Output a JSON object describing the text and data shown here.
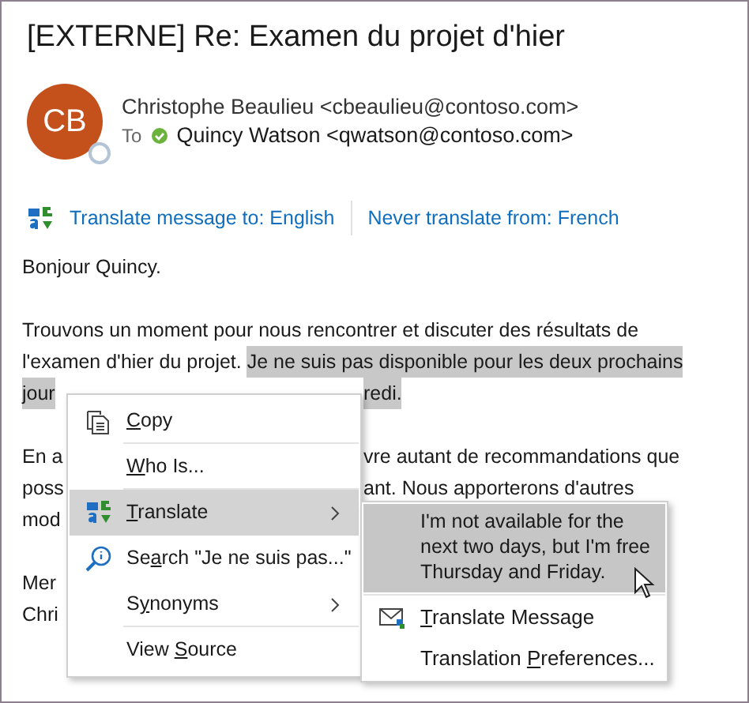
{
  "message": {
    "subject": "[EXTERNE] Re: Examen du projet d'hier",
    "sender": {
      "initials": "CB",
      "name": "Christophe Beaulieu <cbeaulieu@contoso.com>"
    },
    "to_label": "To",
    "recipient": "Quincy Watson <qwatson@contoso.com>"
  },
  "translate_bar": {
    "links": [
      "Translate message to: English",
      "Never translate from: French"
    ]
  },
  "body": [
    [
      {
        "left": [
          {
            "text": "Bonjour Quincy.",
            "highlighted": false
          }
        ]
      }
    ],
    [
      {
        "left": [
          {
            "text": "Trouvons un moment pour nous rencontrer et discuter des résultats de",
            "highlighted": false
          }
        ]
      },
      {
        "left": [
          {
            "text": "l'examen d'hier du projet. ",
            "highlighted": false
          },
          {
            "text": "Je ne suis pas disponible pour les deux prochains",
            "highlighted": true
          }
        ]
      },
      {
        "left": [
          {
            "text": "jour",
            "highlighted": true
          }
        ],
        "right": [
          {
            "text": "redi.",
            "highlighted": true
          }
        ]
      }
    ],
    [
      {
        "left": [
          {
            "text": "En a",
            "highlighted": false
          }
        ],
        "right": [
          {
            "text": "vre autant de recommandations que",
            "highlighted": false
          }
        ]
      },
      {
        "left": [
          {
            "text": "poss",
            "highlighted": false
          }
        ],
        "right": [
          {
            "text": "ant. Nous apporterons d'autres",
            "highlighted": false
          }
        ]
      },
      {
        "left": [
          {
            "text": "mod",
            "highlighted": false
          }
        ]
      }
    ],
    [
      {
        "left": [
          {
            "text": "Mer",
            "highlighted": false
          }
        ]
      },
      {
        "left": [
          {
            "text": "Chri",
            "highlighted": false
          }
        ]
      }
    ]
  ],
  "context_menu": {
    "items": [
      {
        "kind": "copy",
        "accel": "C",
        "after": "opy",
        "submenu": false,
        "selected": false,
        "divider_below": true
      },
      {
        "kind": "plain",
        "accel": "W",
        "after": "ho Is...",
        "submenu": false,
        "selected": false,
        "divider_below": true
      },
      {
        "kind": "translate",
        "accel": "T",
        "after": "ranslate",
        "submenu": true,
        "selected": true,
        "divider_below": false
      },
      {
        "kind": "search",
        "before": "Se",
        "accel": "a",
        "after": "rch \"Je ne suis pas...\"",
        "submenu": false,
        "selected": false,
        "divider_below": false
      },
      {
        "kind": "plain",
        "before": "S",
        "accel": "y",
        "after": "nonyms",
        "submenu": true,
        "selected": false,
        "divider_below": true
      },
      {
        "kind": "plain",
        "before": "View ",
        "accel": "S",
        "after": "ource",
        "submenu": false,
        "selected": false,
        "divider_below": false
      }
    ]
  },
  "submenu": {
    "items": [
      {
        "kind": "translation",
        "text": "I'm not available for the next two days, but I'm free Thursday and Friday.",
        "selected": true
      },
      {
        "kind": "mail",
        "accel": "T",
        "after": "ranslate Message",
        "selected": false
      },
      {
        "kind": "plain",
        "before": "Translation ",
        "accel": "P",
        "after": "references...",
        "selected": false
      }
    ]
  }
}
